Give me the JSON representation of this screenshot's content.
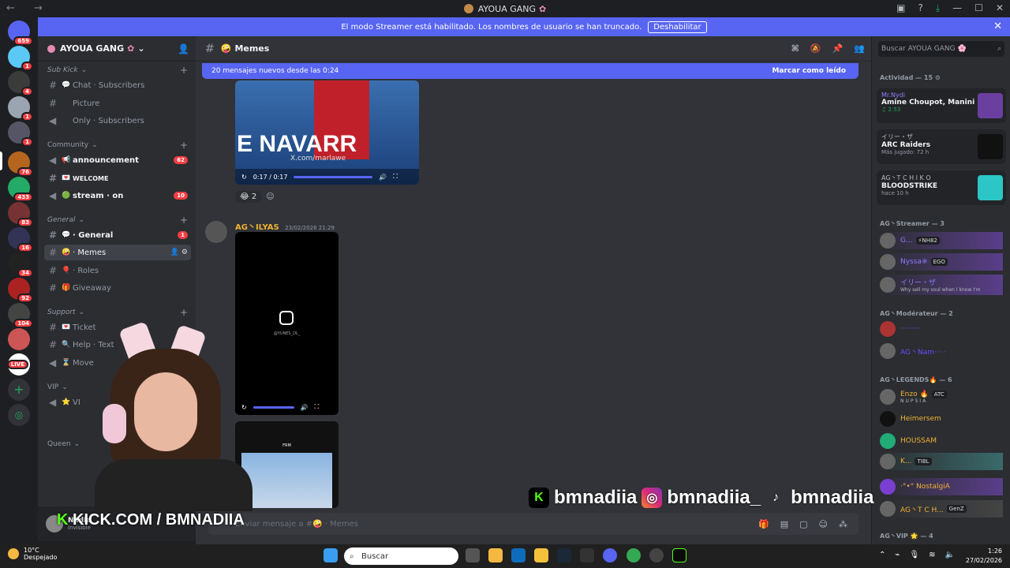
{
  "window": {
    "title": "AYOUA GANG"
  },
  "banner": {
    "text": "El modo Streamer está habilitado. Los nombres de usuario se han truncado.",
    "button": "Deshabilitar"
  },
  "servers": {
    "badges": [
      "659",
      "1",
      "4",
      "1",
      "1",
      "76",
      "433",
      "83",
      "16",
      "34",
      "92",
      "104",
      "LIVE"
    ]
  },
  "guild": {
    "name": "AYOUA GANG"
  },
  "categories": {
    "sub_kick": "Sub Kick",
    "community": "Community",
    "general": "General",
    "support": "Support",
    "vip": "VIP",
    "queen": "Queen"
  },
  "channels": [
    {
      "name": "Chat · Subscribers",
      "emoji": "💬"
    },
    {
      "name": "Picture",
      "emoji": ""
    },
    {
      "name": "Only · Subscribers",
      "emoji": ""
    },
    {
      "name": "announcement",
      "emoji": "📢",
      "count": "62"
    },
    {
      "name": "WELCOME",
      "emoji": "💌"
    },
    {
      "name": "stream · on",
      "emoji": "🟢",
      "count": "10"
    },
    {
      "name": "· General",
      "emoji": "💬",
      "count": "1"
    },
    {
      "name": "· Memes",
      "emoji": "🤪"
    },
    {
      "name": "· Roles",
      "emoji": "🎈"
    },
    {
      "name": "Giveaway",
      "emoji": "🎁"
    },
    {
      "name": "Ticket",
      "emoji": "💌"
    },
    {
      "name": "Help · Text",
      "emoji": "🔍"
    },
    {
      "name": "Move",
      "emoji": "⌛"
    },
    {
      "name": "VI",
      "emoji": "⭐"
    }
  ],
  "user": {
    "name": "Nadia",
    "status": "Invisible"
  },
  "chat": {
    "channel": "Memes",
    "new_messages": "20 mensajes nuevos desde las 0:24",
    "mark_read": "Marcar como leído",
    "video1_time": "0:17 / 0:17",
    "video1_watermark": "X.com/marlawe",
    "video1_text": "E NAVARR",
    "reaction_count": "2",
    "author": "AG丶ILYAS",
    "timestamp": "23/02/2026 21:29",
    "video2_caption": "@YUNES_DL_",
    "video3_caption": "FRM",
    "composer_placeholder": "Enviar mensaje a #🤪 · Memes"
  },
  "members": {
    "search_placeholder": "Buscar AYOUA GANG 🌸",
    "activity_header": "Actividad — 15",
    "activities": [
      {
        "user": "Mr.Nydi",
        "title": "Amine Choupot, Manini",
        "sub": "♫ 2:53"
      },
      {
        "user": "イリー・ザ",
        "title": "ARC Raiders",
        "sub": "Más jugado: 72 h"
      },
      {
        "user": "AG丶T C H I K O",
        "title": "BLOODSTRIKE",
        "sub": "hace 10 h"
      }
    ],
    "streamer_header": "AG丶Streamer — 3",
    "streamers": [
      {
        "name": "G...",
        "tag": "⚡NH82"
      },
      {
        "name": "Nyssa※",
        "tag": "EGO"
      },
      {
        "name": "イリー・ザ",
        "tag": "Why sell my soul when I know I'm"
      }
    ],
    "mod_header": "AG丶Modérateur — 2",
    "mods": [
      {
        "name": "·········"
      },
      {
        "name": "AG丶Nam··· ·"
      }
    ],
    "legends_header": "AG丶LEGENDS🔥 — 6",
    "legends": [
      {
        "name": "Enzo 🔥",
        "tag": "ATC",
        "sub": "NUPSIA"
      },
      {
        "name": "Heimersem",
        "tag": ""
      },
      {
        "name": "HOUSSAM",
        "tag": ""
      },
      {
        "name": "K...",
        "tag": "TIBL"
      },
      {
        "name": "·°•° NostalgiA",
        "tag": ""
      },
      {
        "name": "AG丶T C H...",
        "tag": "GenZ"
      }
    ],
    "vip_header": "AG丶VIP 🌟 — 4"
  },
  "overlay": {
    "kick": "KICK.COM / BMNADIIA",
    "handle1": "bmnadiia",
    "handle2": "bmnadiia_",
    "handle3": "bmnadiia"
  },
  "taskbar": {
    "temp": "10°C",
    "weather": "Despejado",
    "search": "Buscar",
    "time": "1:26",
    "date": "27/02/2026"
  },
  "colors": {
    "accent": "#5865f2",
    "kick": "#53fc18",
    "danger": "#f23f43"
  }
}
